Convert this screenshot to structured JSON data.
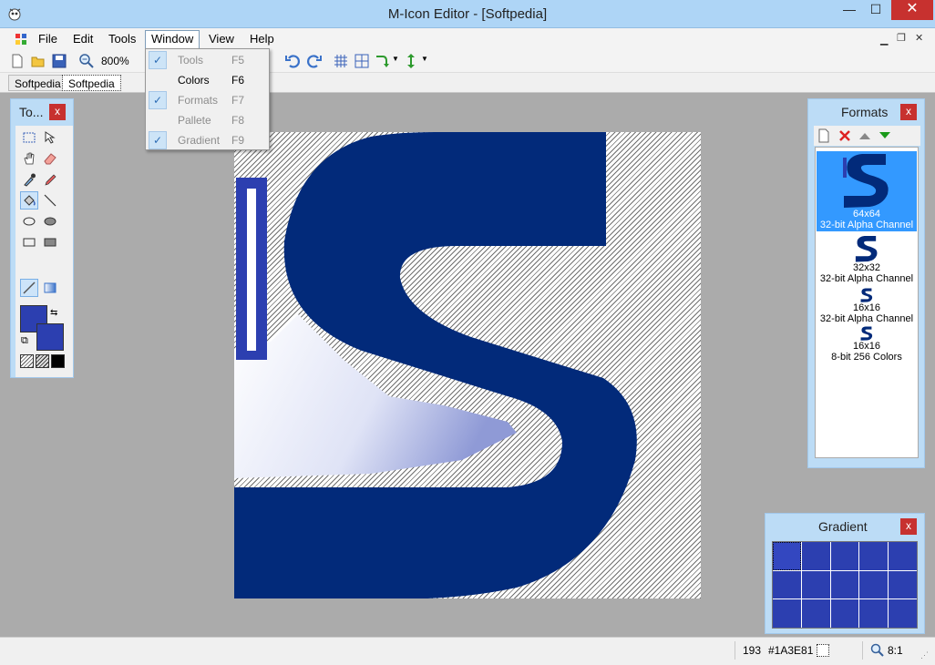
{
  "window": {
    "title": "M-Icon Editor - [Softpedia]",
    "minimize": "—",
    "maximize": "☐",
    "close": "✕"
  },
  "menu": {
    "items": [
      "File",
      "Edit",
      "Tools",
      "Window",
      "View",
      "Help"
    ],
    "open_menu": "Window"
  },
  "toolbar": {
    "zoom": "800%"
  },
  "doc_tabs": [
    "Softpedia",
    "Softpedia"
  ],
  "window_menu": [
    {
      "label": "Tools",
      "shortcut": "F5",
      "checked": true,
      "enabled": false
    },
    {
      "label": "Colors",
      "shortcut": "F6",
      "checked": false,
      "enabled": true
    },
    {
      "label": "Formats",
      "shortcut": "F7",
      "checked": true,
      "enabled": false
    },
    {
      "label": "Pallete",
      "shortcut": "F8",
      "checked": false,
      "enabled": false
    },
    {
      "label": "Gradient",
      "shortcut": "F9",
      "checked": true,
      "enabled": false
    }
  ],
  "tools_panel": {
    "title": "To...",
    "close": "x",
    "primary_color": "#2c3fb0",
    "secondary_color": "#2c3fb0"
  },
  "formats_panel": {
    "title": "Formats",
    "close": "x",
    "items": [
      {
        "size": "64x64",
        "depth": "32-bit Alpha Channel",
        "selected": true
      },
      {
        "size": "32x32",
        "depth": "32-bit Alpha Channel",
        "selected": false
      },
      {
        "size": "16x16",
        "depth": "32-bit Alpha Channel",
        "selected": false
      },
      {
        "size": "16x16",
        "depth": "8-bit 256 Colors",
        "selected": false
      }
    ]
  },
  "gradient_panel": {
    "title": "Gradient",
    "close": "x"
  },
  "status": {
    "value": "193",
    "color_hex": "#1A3E81",
    "ratio": "8:1"
  },
  "colors": {
    "icon_blue": "#022a7a",
    "accent_blue": "#2c3fb0",
    "panel_bg": "#bcdcf6",
    "close_red": "#c7312f",
    "selection": "#3399ff"
  }
}
